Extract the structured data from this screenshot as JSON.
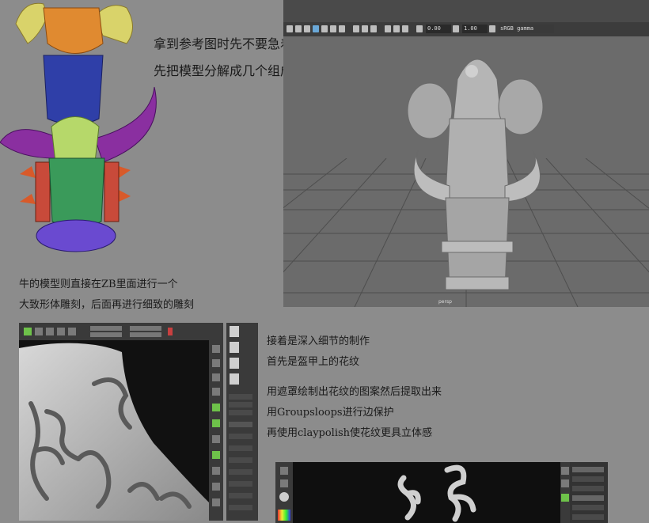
{
  "texts": {
    "line1": "拿到参考图时先不要急着开始制作",
    "line2": "先把模型分解成几个组成部分",
    "line3": "牛的模型则直接在ZB里面进行一个",
    "line4": "大致形体雕刻，后面再进行细致的雕刻",
    "line5": "接着是深入细节的制作",
    "line6": "首先是盔甲上的花纹",
    "line7": "用遮罩绘制出花纹的图案然后提取出来",
    "line8": "用Groupsloops进行边保护",
    "line9": "再使用claypolish使花纹更具立体感"
  },
  "maya": {
    "field1": "0.00",
    "field2": "1.00",
    "colorspace": "sRGB gamma",
    "camera_label": "persp"
  },
  "colors": {
    "background": "#8c8c8c",
    "maya_bg": "#6b6b6b",
    "zbrush_bg": "#2b2b2b",
    "zbrush_green": "#6ec24a",
    "ref_yellow": "#d9d36a",
    "ref_blue": "#2f3fa8",
    "ref_purple": "#8a2fa0",
    "ref_green": "#3a9a5a",
    "ref_orange": "#d85a2a"
  }
}
